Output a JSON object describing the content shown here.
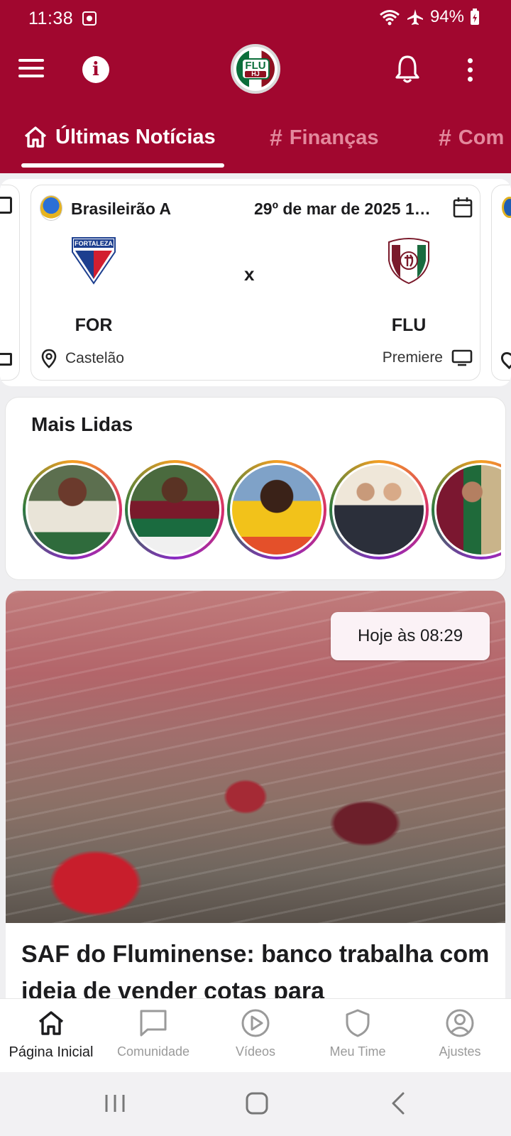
{
  "status_bar": {
    "time": "11:38",
    "battery": "94%"
  },
  "header": {
    "logo_text": "FLU",
    "logo_sub": "HJ",
    "tabs": [
      {
        "label": "Últimas Notícias",
        "icon": "home-icon"
      },
      {
        "label": "Finanças",
        "icon": "hash-icon"
      },
      {
        "label": "Com",
        "icon": "hash-icon"
      }
    ]
  },
  "match": {
    "league": "Brasileirão A",
    "date": "29º de mar de 2025 1…",
    "home_code": "FOR",
    "home_crest_text": "FORTALEZA",
    "away_code": "FLU",
    "versus": "x",
    "venue": "Castelão",
    "broadcast": "Premiere"
  },
  "most_read": {
    "title": "Mais Lidas",
    "stories": [
      {
        "name": "story-1"
      },
      {
        "name": "story-2"
      },
      {
        "name": "story-3"
      },
      {
        "name": "story-4"
      },
      {
        "name": "story-5"
      }
    ]
  },
  "news": {
    "timestamp": "Hoje às 08:29",
    "title": "SAF do Fluminense: banco trabalha com ideia de vender cotas para"
  },
  "bottom_nav": [
    {
      "label": "Página Inicial",
      "icon": "home-icon",
      "active": true
    },
    {
      "label": "Comunidade",
      "icon": "chat-icon",
      "active": false
    },
    {
      "label": "Vídeos",
      "icon": "play-icon",
      "active": false
    },
    {
      "label": "Meu Time",
      "icon": "shield-icon",
      "active": false
    },
    {
      "label": "Ajustes",
      "icon": "profile-icon",
      "active": false
    }
  ],
  "colors": {
    "brand": "#a1072f",
    "tab_inactive": "#e3899d",
    "nav_active": "#1c1c1e",
    "nav_inactive": "#9a9a9a"
  }
}
